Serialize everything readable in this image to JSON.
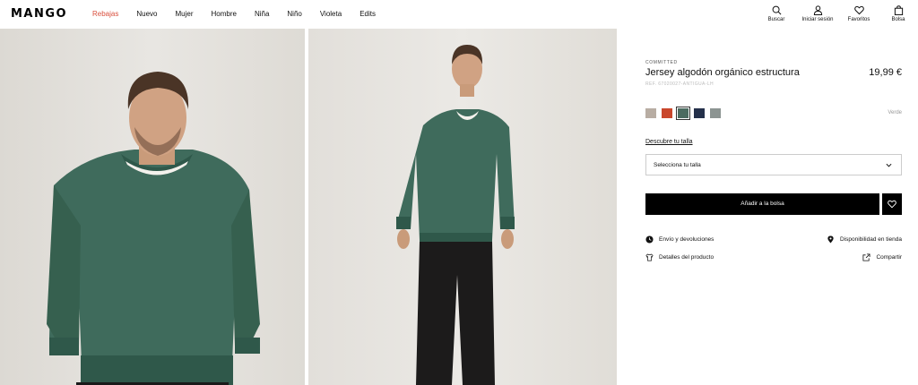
{
  "header": {
    "logo": "MANGO",
    "nav": [
      "Rebajas",
      "Nuevo",
      "Mujer",
      "Hombre",
      "Niña",
      "Niño",
      "Violeta",
      "Edits"
    ],
    "actions": {
      "search": "Buscar",
      "login": "Iniciar sesión",
      "favorites": "Favoritos",
      "bag": "Bolsa"
    }
  },
  "product": {
    "tag": "COMMITTED",
    "title": "Jersey algodón orgánico estructura",
    "price": "19,99 €",
    "ref": "REF. 67020027-ANTIGUA-LH",
    "selected_color": "Verde",
    "swatches": [
      {
        "name": "beige",
        "color": "#b8ada3"
      },
      {
        "name": "rojo",
        "color": "#c9472c"
      },
      {
        "name": "verde",
        "color": "#4b6b60"
      },
      {
        "name": "azul marino",
        "color": "#24304a"
      },
      {
        "name": "gris",
        "color": "#8c9492"
      }
    ],
    "size_link": "Descubre tu talla",
    "size_select": "Selecciona tu talla",
    "add_to_bag": "Añadir a la bolsa",
    "shipping": "Envío y devoluciones",
    "details": "Detalles del producto",
    "availability": "Disponibilidad en tienda",
    "share": "Compartir"
  },
  "colors": {
    "sale": "#d94f3d",
    "sweater": "#3f6b5c",
    "button": "#000000"
  }
}
